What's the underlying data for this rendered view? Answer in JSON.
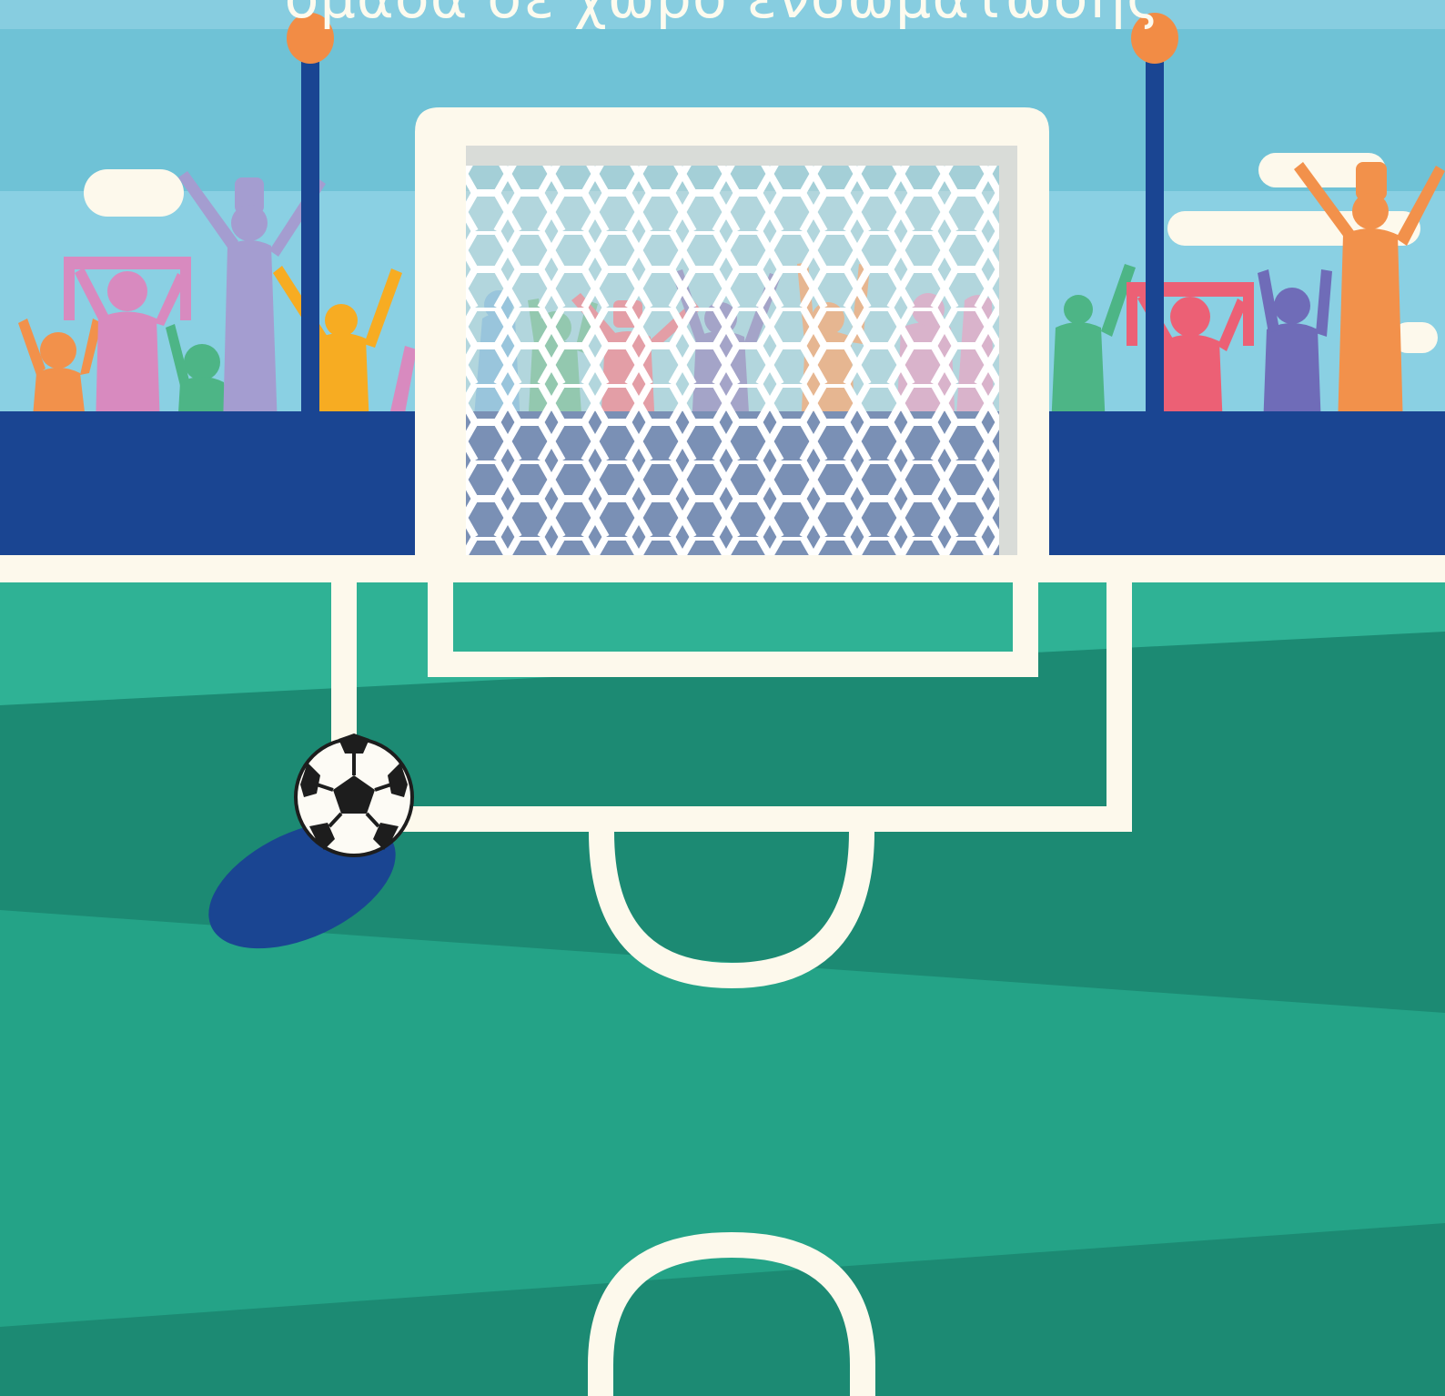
{
  "headline": {
    "text": "ομάδα σε χώρο ενσωμάτωσης"
  },
  "colors": {
    "sky": "#6fc2d6",
    "sky_light": "#8ad0e3",
    "stand_blue": "#1a4592",
    "pitch_light": "#2fb295",
    "pitch_dark": "#1c8a73",
    "pitch_mid": "#24a387",
    "line_cream": "#fdf9ec",
    "net_grey": "#d9dcd8",
    "pole_cap": "#f28c45",
    "fan_orange": "#f2914b",
    "fan_pink": "#d88abf",
    "fan_lavender": "#a49dd0",
    "fan_green": "#4db586",
    "fan_yellow": "#f7ac22",
    "fan_red": "#ec6075",
    "fan_purple": "#6f6cb8",
    "fan_blue": "#59aee0"
  },
  "icons": [
    "soccer-ball-icon"
  ]
}
